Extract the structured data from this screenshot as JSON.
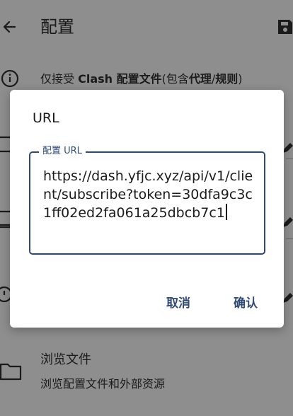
{
  "header": {
    "title": "配置",
    "back_icon": "arrow-left-icon",
    "save_icon": "save-icon"
  },
  "notice": {
    "icon": "info-icon",
    "parts": [
      "仅接受 ",
      "Clash 配置文件",
      "(包含",
      "代理",
      "/",
      "规则",
      ")"
    ]
  },
  "browse": {
    "icon": "folder-icon",
    "title": "浏览文件",
    "subtitle": "浏览配置文件和外部资源"
  },
  "dialog": {
    "title": "URL",
    "field_label": "配置 URL",
    "field_value": "https://dash.yfjc.xyz/api/v1/client/subscribe?token=30dfa9c3c1ff02ed2fa061a25dbcb7c1",
    "cancel_label": "取消",
    "confirm_label": "确认"
  },
  "colors": {
    "scrim": "#8e8e8e",
    "dialog_bg": "#ffffff",
    "accent": "#2f4b75",
    "text": "#1b1b1b"
  }
}
